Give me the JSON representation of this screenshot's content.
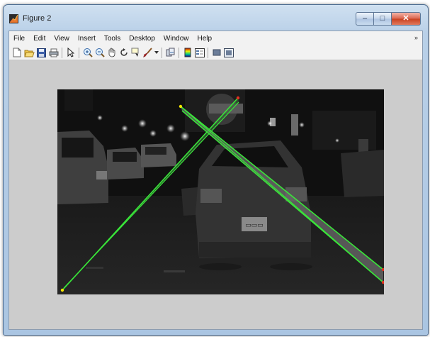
{
  "window": {
    "title": "Figure 2"
  },
  "menu": {
    "items": [
      "File",
      "Edit",
      "View",
      "Insert",
      "Tools",
      "Desktop",
      "Window",
      "Help"
    ],
    "overflow_glyph": "»"
  },
  "toolbar": {
    "groups": [
      [
        "new-figure-icon",
        "open-file-icon",
        "save-icon",
        "print-icon"
      ],
      [
        "pointer-icon"
      ],
      [
        "zoom-in-icon",
        "zoom-out-icon",
        "pan-icon",
        "rotate-icon",
        "data-cursor-icon",
        "brush-icon",
        "brush-dropdown-icon"
      ],
      [
        "link-icon"
      ],
      [
        "colorbar-icon",
        "legend-icon"
      ],
      [
        "hide-tools-icon",
        "show-tools-icon"
      ]
    ]
  },
  "window_buttons": {
    "minimize": "–",
    "maximize": "□",
    "close": "✕"
  },
  "colors": {
    "line": "#39e639",
    "endpoint_yellow": "#f5e400",
    "endpoint_red": "#e03020"
  }
}
